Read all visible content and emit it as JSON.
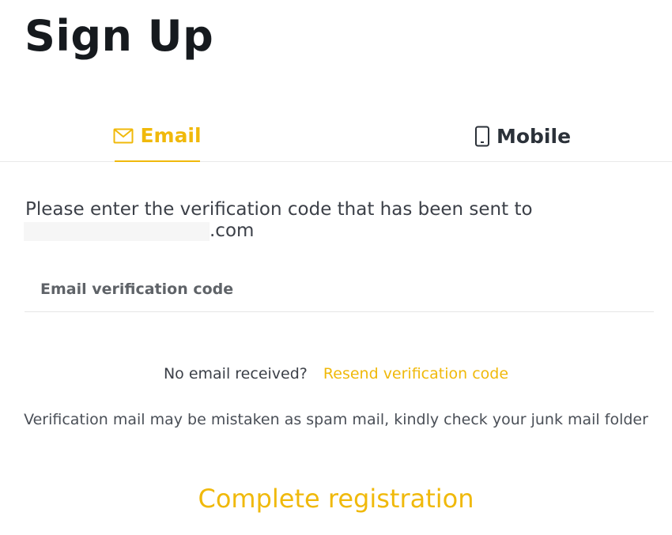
{
  "page": {
    "title": "Sign Up"
  },
  "tabs": [
    {
      "label": "Email",
      "icon": "mail-icon",
      "active": true
    },
    {
      "label": "Mobile",
      "icon": "phone-icon",
      "active": false
    }
  ],
  "verification": {
    "instruction": "Please enter the verification code that has been sent to",
    "email_suffix": ".com",
    "code_placeholder": "Email verification code",
    "code_value": ""
  },
  "resend": {
    "prompt": "No email received?",
    "link_label": "Resend verification code"
  },
  "spam_note": "Verification mail may be mistaken as spam mail, kindly check your junk mail folder",
  "actions": {
    "complete_label": "Complete registration"
  },
  "colors": {
    "accent": "#f0b90b",
    "text_dark": "#161a1e",
    "text_body": "#3c4048",
    "divider": "#e9e9e9"
  }
}
